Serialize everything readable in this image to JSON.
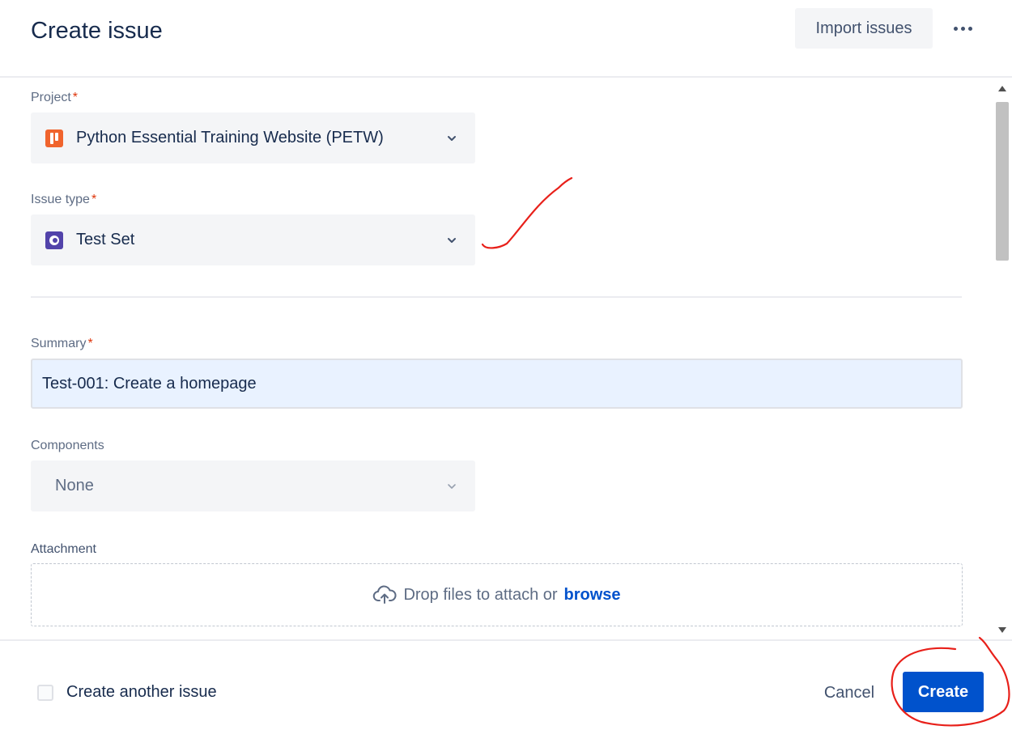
{
  "dialog": {
    "title": "Create issue",
    "import_label": "Import issues"
  },
  "fields": {
    "project": {
      "label": "Project",
      "required_mark": "*",
      "value": "Python Essential Training Website (PETW)"
    },
    "issue_type": {
      "label": "Issue type",
      "required_mark": "*",
      "value": "Test Set"
    },
    "summary": {
      "label": "Summary",
      "required_mark": "*",
      "value": "Test-001: Create a homepage"
    },
    "components": {
      "label": "Components",
      "value": "None"
    },
    "attachment": {
      "label": "Attachment",
      "drop_text": "Drop files to attach or",
      "browse_label": "browse"
    }
  },
  "footer": {
    "create_another_label": "Create another issue",
    "cancel_label": "Cancel",
    "create_label": "Create"
  },
  "colors": {
    "primary": "#0052cc",
    "project_icon": "#f0642d",
    "issue_type_icon": "#5243aa",
    "annotation": "#e8201a"
  },
  "icons": {
    "project": "project-avatar-icon",
    "issue_type": "test-set-icon",
    "dropdown": "chevron-down-icon",
    "upload": "cloud-upload-icon",
    "more": "more-horizontal-icon"
  }
}
